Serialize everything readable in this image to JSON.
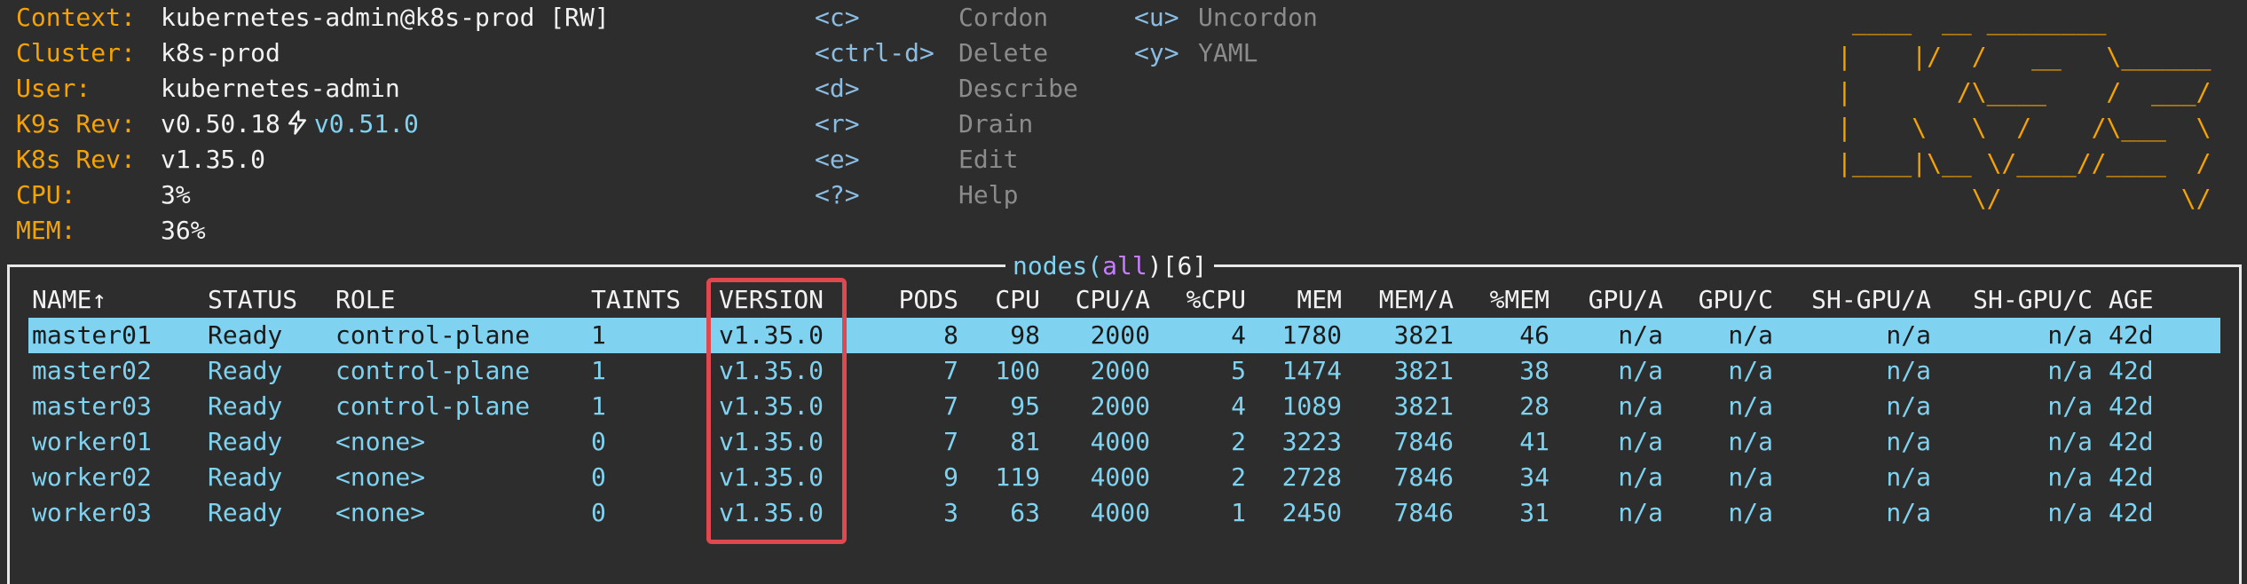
{
  "info": [
    {
      "label": "Context:",
      "value": "kubernetes-admin@k8s-prod [RW]"
    },
    {
      "label": "Cluster:",
      "value": "k8s-prod"
    },
    {
      "label": "User:",
      "value": "kubernetes-admin"
    },
    {
      "label": "K9s Rev:",
      "value": "v0.50.18",
      "upgrade": "v0.51.0"
    },
    {
      "label": "K8s Rev:",
      "value": "v1.35.0"
    },
    {
      "label": "CPU:",
      "value": "3%"
    },
    {
      "label": "MEM:",
      "value": "36%"
    }
  ],
  "shortcuts_col1": [
    {
      "key": "<c>",
      "action": "Cordon"
    },
    {
      "key": "<ctrl-d>",
      "action": "Delete"
    },
    {
      "key": "<d>",
      "action": "Describe"
    },
    {
      "key": "<r>",
      "action": "Drain"
    },
    {
      "key": "<e>",
      "action": "Edit"
    },
    {
      "key": "<?>",
      "action": "Help"
    }
  ],
  "shortcuts_col2": [
    {
      "key": "<u>",
      "action": "Uncordon"
    },
    {
      "key": "<y>",
      "action": "YAML"
    }
  ],
  "logo": " ____  __ ________\n|    |/  /   __   \\______\n|       /\\____    /  ___/\n|    \\   \\  /    /\\___  \\\n|____|\\__ \\/____//____  /\n         \\/            \\/",
  "table": {
    "title_resource": "nodes(",
    "title_ns": "all",
    "title_close": ")[",
    "title_count": "6",
    "title_end": "]",
    "columns": [
      "NAME↑",
      "STATUS",
      "ROLE",
      "TAINTS",
      "VERSION",
      "PODS",
      "CPU",
      "CPU/A",
      "%CPU",
      "MEM",
      "MEM/A",
      "%MEM",
      "GPU/A",
      "GPU/C",
      "SH-GPU/A",
      "SH-GPU/C",
      "AGE"
    ],
    "rows": [
      [
        "master01",
        "Ready",
        "control-plane",
        "1",
        "v1.35.0",
        "8",
        "98",
        "2000",
        "4",
        "1780",
        "3821",
        "46",
        "n/a",
        "n/a",
        "n/a",
        "n/a",
        "42d"
      ],
      [
        "master02",
        "Ready",
        "control-plane",
        "1",
        "v1.35.0",
        "7",
        "100",
        "2000",
        "5",
        "1474",
        "3821",
        "38",
        "n/a",
        "n/a",
        "n/a",
        "n/a",
        "42d"
      ],
      [
        "master03",
        "Ready",
        "control-plane",
        "1",
        "v1.35.0",
        "7",
        "95",
        "2000",
        "4",
        "1089",
        "3821",
        "28",
        "n/a",
        "n/a",
        "n/a",
        "n/a",
        "42d"
      ],
      [
        "worker01",
        "Ready",
        "<none>",
        "0",
        "v1.35.0",
        "7",
        "81",
        "4000",
        "2",
        "3223",
        "7846",
        "41",
        "n/a",
        "n/a",
        "n/a",
        "n/a",
        "42d"
      ],
      [
        "worker02",
        "Ready",
        "<none>",
        "0",
        "v1.35.0",
        "9",
        "119",
        "4000",
        "2",
        "2728",
        "7846",
        "34",
        "n/a",
        "n/a",
        "n/a",
        "n/a",
        "42d"
      ],
      [
        "worker03",
        "Ready",
        "<none>",
        "0",
        "v1.35.0",
        "3",
        "63",
        "4000",
        "1",
        "2450",
        "7846",
        "31",
        "n/a",
        "n/a",
        "n/a",
        "n/a",
        "42d"
      ]
    ],
    "selected_row": 0,
    "highlighted_column": "VERSION"
  },
  "colors": {
    "background": "#2d2d2d",
    "label": "#f5a300",
    "row_text": "#7fd3f0",
    "selected_row_bg": "#7fd3f0",
    "highlight_box": "#e0484f"
  }
}
